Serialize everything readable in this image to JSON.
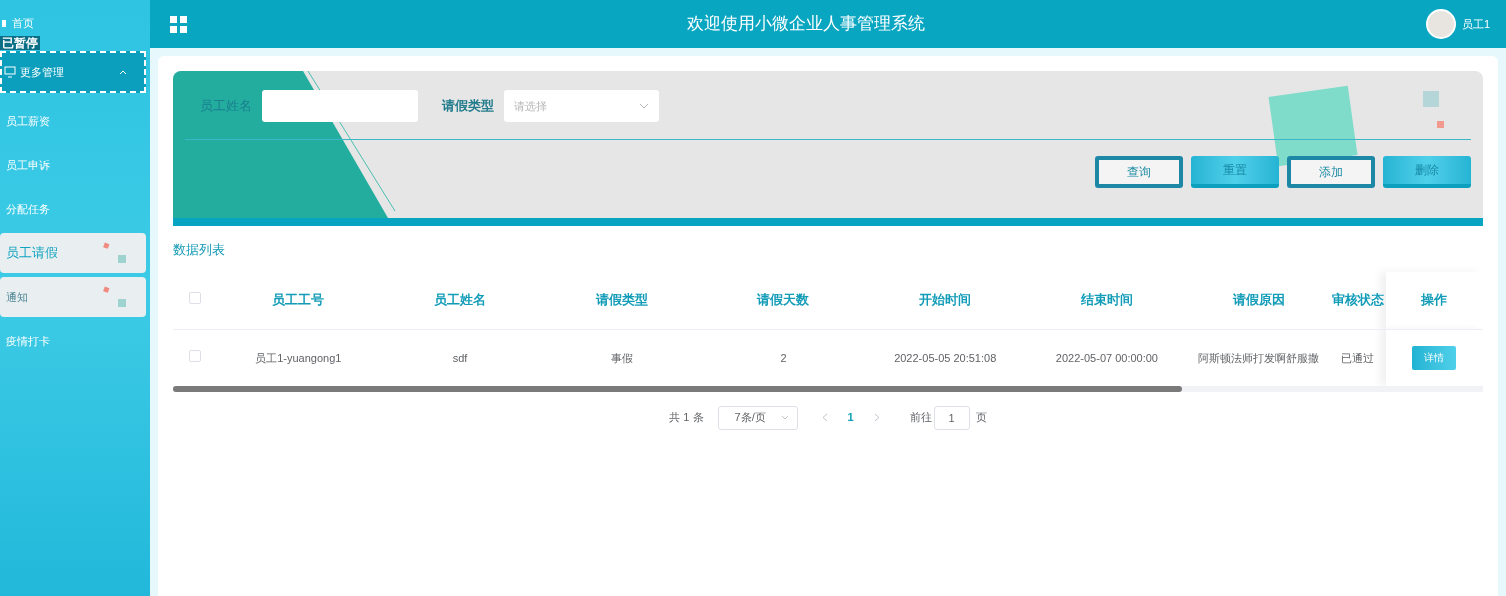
{
  "header": {
    "title": "欢迎使用小微企业人事管理系统",
    "user": "员工1"
  },
  "player_overlay": "已暂停",
  "sidebar": {
    "items": [
      {
        "label": "首页",
        "kind": "link",
        "selected": false
      },
      {
        "label": "更多管理",
        "kind": "group",
        "expanded": true,
        "focused": true,
        "children": [
          {
            "label": "员工薪资",
            "selected": false,
            "hovered": false
          },
          {
            "label": "员工申诉",
            "selected": false,
            "hovered": false
          },
          {
            "label": "分配任务",
            "selected": false,
            "hovered": false
          },
          {
            "label": "员工请假",
            "selected": true,
            "hovered": false
          },
          {
            "label": "通知",
            "selected": false,
            "hovered": true
          },
          {
            "label": "疫情打卡",
            "selected": false,
            "hovered": false
          }
        ]
      }
    ]
  },
  "search": {
    "fields": [
      {
        "label": "员工姓名",
        "kind": "text"
      },
      {
        "label": "请假类型",
        "kind": "select",
        "placeholder": "请选择"
      }
    ],
    "buttons": [
      {
        "label": "查询",
        "kind": "outline"
      },
      {
        "label": "重置",
        "kind": "filled"
      },
      {
        "label": "添加",
        "kind": "outline"
      },
      {
        "label": "删除",
        "kind": "filled"
      }
    ]
  },
  "list_title": "数据列表",
  "table": {
    "columns": [
      "员工工号",
      "员工姓名",
      "请假类型",
      "请假天数",
      "开始时间",
      "结束时间",
      "请假原因",
      "审核状态",
      "操作"
    ],
    "rows": [
      {
        "checked": false,
        "cells": [
          "员工1-yuangong1",
          "sdf",
          "事假",
          "2",
          "2022-05-05 20:51:08",
          "2022-05-07 00:00:00",
          "阿斯顿法师打发啊舒服撒",
          "已通过"
        ],
        "action": "详情"
      }
    ],
    "header_checked": false
  },
  "pagination": {
    "total": "共 1 条",
    "page_size": "7条/页",
    "pages": [
      {
        "label": "1",
        "selected": true
      }
    ],
    "goto_label": "前往",
    "goto_value": "1",
    "goto_suffix": "页"
  }
}
